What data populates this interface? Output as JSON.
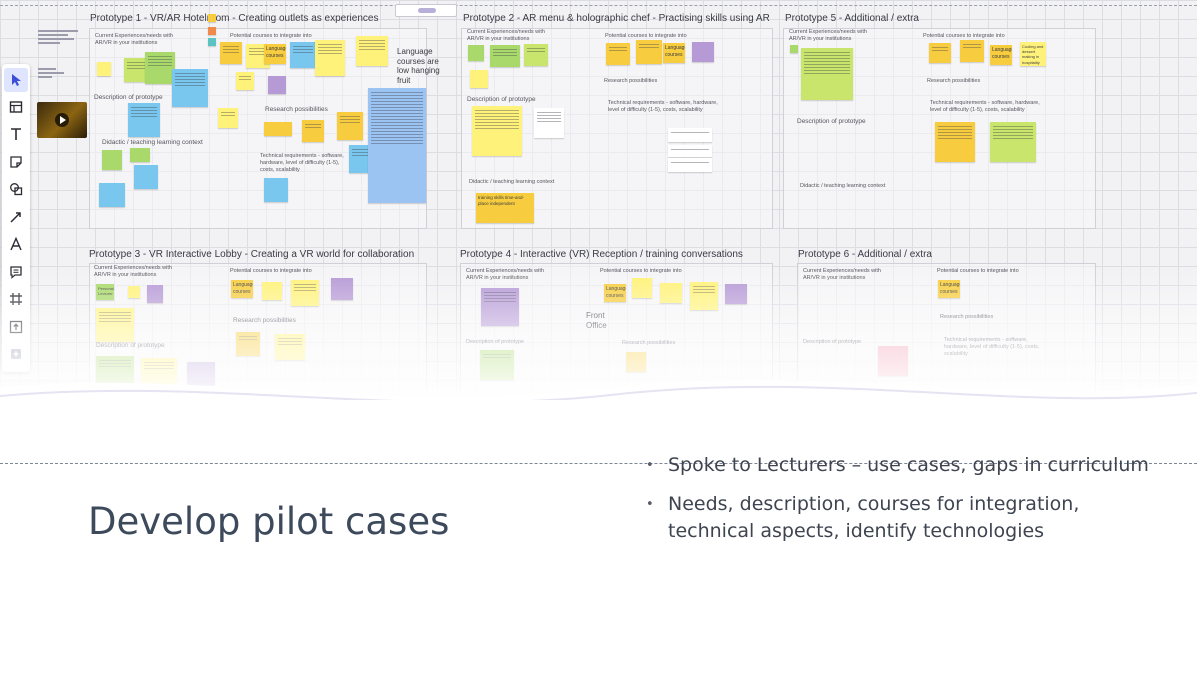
{
  "board": {
    "frames": [
      {
        "title": "Prototype 1 - VR/AR Hotelroom - Creating outlets as experiences",
        "labels": {
          "needs": "Current Experiences/needs with AR/VR in your institutions",
          "courses": "Potential courses to integrate into",
          "description": "Description of prototype",
          "didactic": "Didactic / teaching learning context",
          "research": "Research possibilities",
          "technical": "Technical requirements - software, hardware, level of difficulty (1-5), costs, scalability"
        },
        "notes": {
          "language_note": "Language courses",
          "low_hanging": "Language courses are low hanging fruit"
        }
      },
      {
        "title": "Prototype 2 - AR menu & holographic chef - Practising skills using AR",
        "labels": {
          "needs": "Current Experiences/needs with AR/VR in your institutions",
          "courses": "Potential courses to integrate into",
          "description": "Description of prototype",
          "didactic": "Didactic / teaching learning context",
          "research": "Research possibilities",
          "technical": "Technical requirements - software, hardware, level of difficulty (1-5), costs, scalability"
        },
        "notes": {
          "language_note": "Language courses",
          "training": "training skills time-and-place independent"
        }
      },
      {
        "title": "Prototype 5 - Additional / extra",
        "labels": {
          "needs": "Current Experiences/needs with AR/VR in your institutions",
          "courses": "Potential courses to integrate into",
          "description": "Description of prototype",
          "didactic": "Didactic / teaching learning context",
          "research": "Research possibilities",
          "technical": "Technical requirements - software, hardware, level of difficulty (1-5), costs, scalability"
        },
        "notes": {
          "language_note": "Language courses",
          "cooling": "Cooling and dessert making in hospitality"
        }
      },
      {
        "title": "Prototype 3 - VR Interactive Lobby - Creating a VR world for collaboration",
        "labels": {
          "needs": "Current Experiences/needs with AR/VR in your institutions",
          "courses": "Potential courses to integrate into",
          "description": "Description of prototype",
          "research": "Research possibilities"
        },
        "notes": {
          "language_note": "Language courses",
          "personal": "Personal Lecturer"
        }
      },
      {
        "title": "Prototype 4 - Interactive (VR) Reception / training conversations",
        "labels": {
          "needs": "Current Experiences/needs with AR/VR in your institutions",
          "courses": "Potential courses to integrate into",
          "description": "Description of prototype",
          "research": "Research possibilities"
        },
        "notes": {
          "language_note": "Language courses",
          "front_office": "Front Office"
        }
      },
      {
        "title": "Prototype 6 - Additional / extra",
        "labels": {
          "needs": "Current Experiences/needs with AR/VR in your institutions",
          "courses": "Potential courses to integrate into",
          "description": "Description of prototype",
          "research": "Research possibilities",
          "technical": "Technical requirements - software, hardware, level of difficulty (1-5), costs, scalability"
        },
        "notes": {
          "language_note": "Language courses"
        }
      }
    ],
    "toolbar_icons": [
      "select-cursor-icon",
      "table-icon",
      "text-icon",
      "sticky-note-icon",
      "shapes-icon",
      "arrow-pen-icon",
      "font-icon",
      "comment-icon",
      "frame-icon",
      "upload-icon",
      "more-apps-icon"
    ]
  },
  "slide": {
    "title": "Develop pilot cases",
    "bullet_symbol": "•",
    "bullets": [
      "Spoke to Lecturers – use cases, gaps in curriculum",
      "Needs, description, courses for integration, technical aspects, identify technologies"
    ]
  },
  "colors": {
    "title": "#3d4a5c",
    "body": "#3e4450",
    "sticky_yellow": "#fff27a",
    "sticky_orange": "#f7cd3f",
    "sticky_green": "#a9d96a",
    "sticky_blue": "#79c6ee",
    "sticky_purple": "#b69ad6",
    "toolbar_active": "#3b4fd9"
  }
}
